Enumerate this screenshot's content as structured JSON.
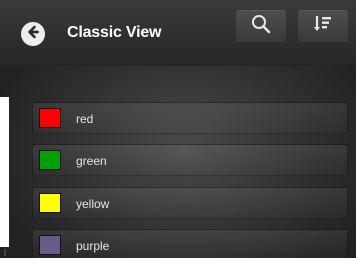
{
  "header": {
    "title": "Classic View"
  },
  "items": [
    {
      "label": "red",
      "color": "#ff0000"
    },
    {
      "label": "green",
      "color": "#00a000"
    },
    {
      "label": "yellow",
      "color": "#ffff00"
    },
    {
      "label": "purple",
      "color": "#6a5a8a"
    }
  ],
  "icons": {
    "back": "back-arrow-icon",
    "search": "search-icon",
    "sort": "sort-icon"
  }
}
